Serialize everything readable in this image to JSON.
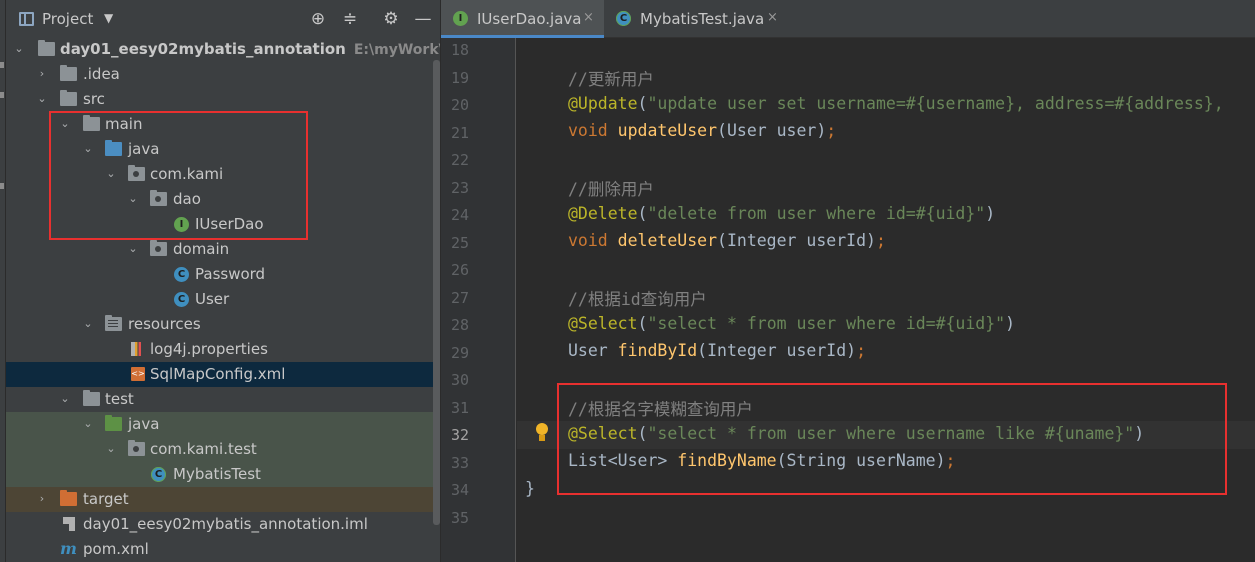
{
  "project_panel": {
    "title": "Project",
    "toolbar": [
      "locate-icon",
      "collapse-all-icon",
      "gear-icon",
      "hide-icon"
    ],
    "tree": [
      {
        "label": "day01_eesy02mybatis_annotation",
        "sub": "E:\\myWork\\Wor",
        "icon": "module-folder"
      },
      {
        "label": ".idea",
        "icon": "folder"
      },
      {
        "label": "src",
        "icon": "folder"
      },
      {
        "label": "main",
        "icon": "folder"
      },
      {
        "label": "java",
        "icon": "source-folder"
      },
      {
        "label": "com.kami",
        "icon": "package"
      },
      {
        "label": "dao",
        "icon": "package"
      },
      {
        "label": "IUserDao",
        "icon": "interface",
        "badge": "I"
      },
      {
        "label": "domain",
        "icon": "package"
      },
      {
        "label": "Password",
        "icon": "class",
        "badge": "C"
      },
      {
        "label": "User",
        "icon": "class",
        "badge": "C"
      },
      {
        "label": "resources",
        "icon": "resources-folder"
      },
      {
        "label": "log4j.properties",
        "icon": "properties-file"
      },
      {
        "label": "SqlMapConfig.xml",
        "icon": "xml-file"
      },
      {
        "label": "test",
        "icon": "folder"
      },
      {
        "label": "java",
        "icon": "test-source-folder"
      },
      {
        "label": "com.kami.test",
        "icon": "package"
      },
      {
        "label": "MybatisTest",
        "icon": "test-class",
        "badge": "C"
      },
      {
        "label": "target",
        "icon": "excluded-folder"
      },
      {
        "label": "day01_eesy02mybatis_annotation.iml",
        "icon": "iml-file"
      },
      {
        "label": "pom.xml",
        "icon": "maven-file",
        "badge": "m"
      }
    ]
  },
  "editor": {
    "tabs": [
      {
        "label": "IUserDao.java",
        "badge": "I",
        "active": true
      },
      {
        "label": "MybatisTest.java",
        "badge": "C",
        "active": false
      }
    ],
    "close_glyph": "×",
    "current_line": 32,
    "line_numbers": [
      "18",
      "19",
      "20",
      "21",
      "22",
      "23",
      "24",
      "25",
      "26",
      "27",
      "28",
      "29",
      "30",
      "31",
      "32",
      "33",
      "34",
      "35"
    ],
    "code": {
      "l19": "//更新用户",
      "l20_anno": "@Update",
      "l20_open": "(",
      "l20_str": "\"update user set username=#{username}, address=#{address},",
      "l21_kw": "void ",
      "l21_fn": "updateUser",
      "l21_rest": "(User user)",
      "l23": "//删除用户",
      "l24_anno": "@Delete",
      "l24_open": "(",
      "l24_str": "\"delete from user where id=#{uid}\"",
      "l24_close": ")",
      "l25_kw": "void ",
      "l25_fn": "deleteUser",
      "l25_rest": "(Integer userId)",
      "l27": "//根据id查询用户",
      "l28_anno": "@Select",
      "l28_open": "(",
      "l28_str": "\"select * from user where id=#{uid}\"",
      "l28_close": ")",
      "l29_type": "User ",
      "l29_fn": "findById",
      "l29_rest": "(Integer userId)",
      "l31": "//根据名字模糊查询用户",
      "l32_anno": "@Select",
      "l32_open": "(",
      "l32_str": "\"select * from user where username like #{uname}\"",
      "l32_close": ")",
      "l33_type": "List<User> ",
      "l33_fn": "findByName",
      "l33_rest": "(String userName)",
      "semicolon": ";",
      "l34": "}"
    }
  },
  "colors": {
    "highlight_box": "#e8302f",
    "selection": "#0d293e",
    "keyword": "#cc7832",
    "annotation": "#bbb529",
    "string": "#6a8759",
    "function": "#ffc66d"
  }
}
